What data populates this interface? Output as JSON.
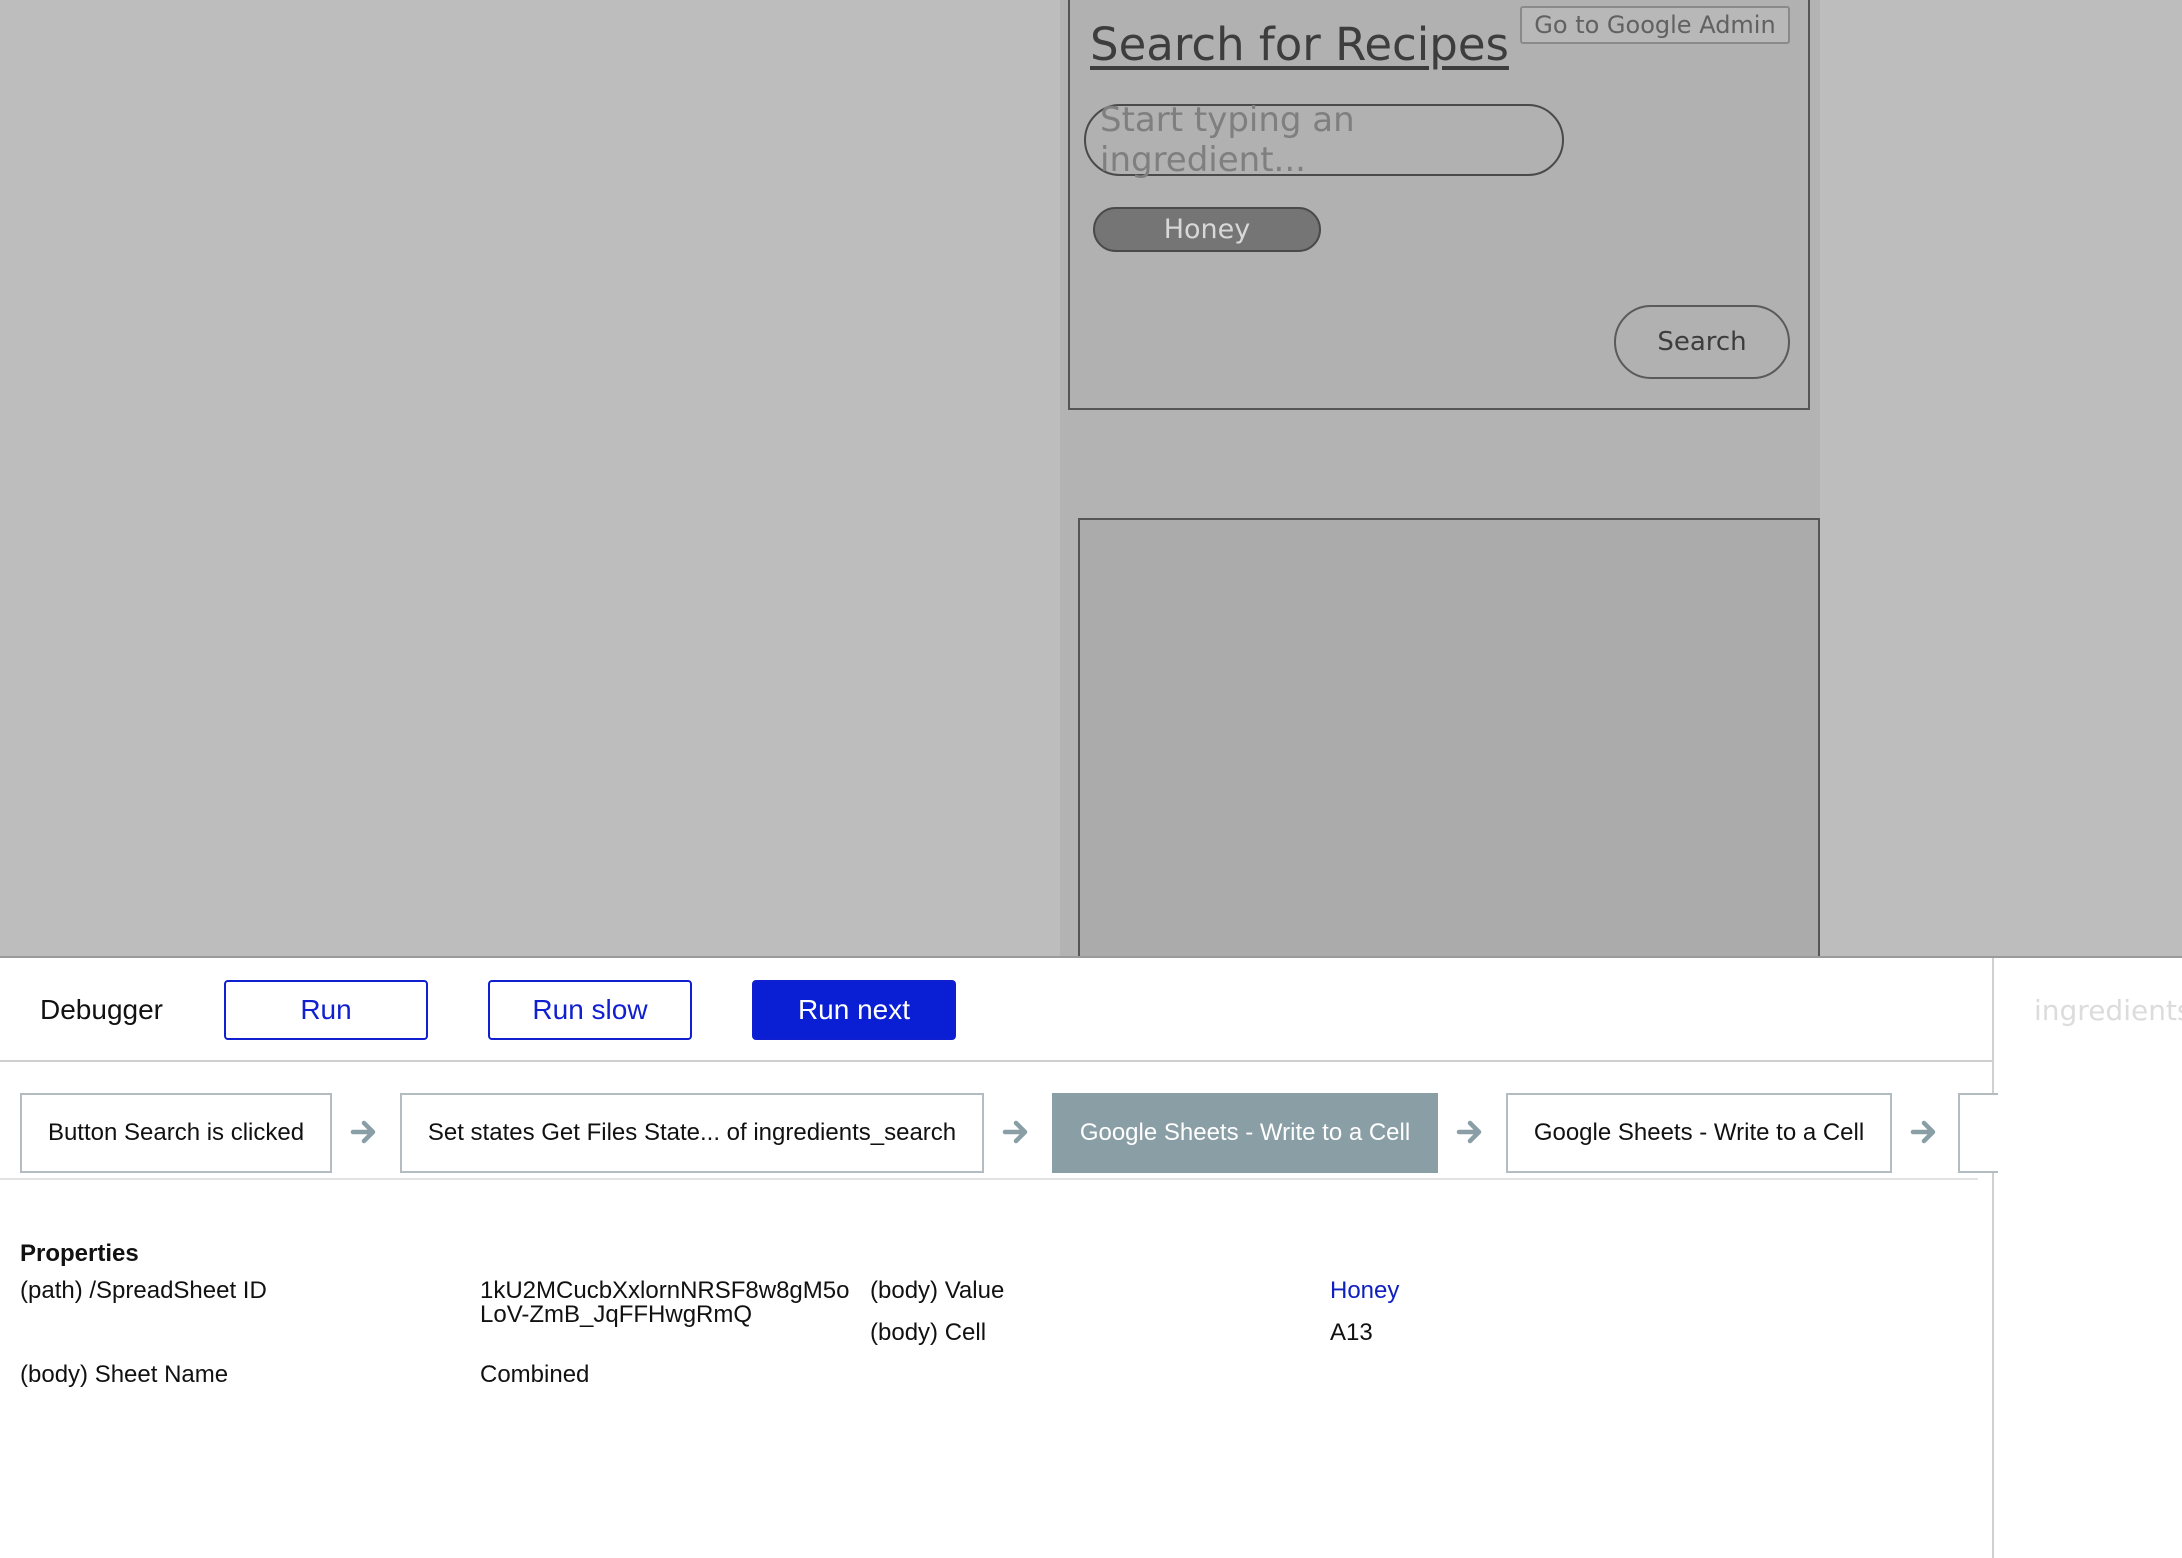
{
  "preview": {
    "title": "Search for Recipes",
    "admin_button": "Go to Google Admin",
    "ingredient_placeholder": "Start typing an ingredient...",
    "selected_chip": "Honey",
    "search_button": "Search"
  },
  "debugger": {
    "title": "Debugger",
    "run_label": "Run",
    "run_slow_label": "Run slow",
    "run_next_label": "Run next",
    "side_tab_label": "ingredients_",
    "steps": [
      {
        "label": "Button Search is clicked",
        "active": false
      },
      {
        "label": "Set states Get Files State... of ingredients_search",
        "active": false
      },
      {
        "label": "Google Sheets - Write to a Cell",
        "active": true
      },
      {
        "label": "Google Sheets - Write to a Cell",
        "active": false
      }
    ],
    "properties": {
      "heading": "Properties",
      "spreadsheet_id_label": "(path) /SpreadSheet ID",
      "spreadsheet_id_line1": "1kU2MCucbXxlornNRSF8w8gM5o",
      "spreadsheet_id_line2": "LoV-ZmB_JqFFHwgRmQ",
      "sheet_name_label": "(body) Sheet Name",
      "sheet_name_value": "Combined",
      "value_label": "(body) Value",
      "value_value": "Honey",
      "cell_label": "(body) Cell",
      "cell_value": "A13"
    }
  },
  "colors": {
    "accent": "#0a1ed4",
    "active_step": "#8a9ea6",
    "overlay": "#bdbdbd",
    "link_value": "#1020c0"
  }
}
